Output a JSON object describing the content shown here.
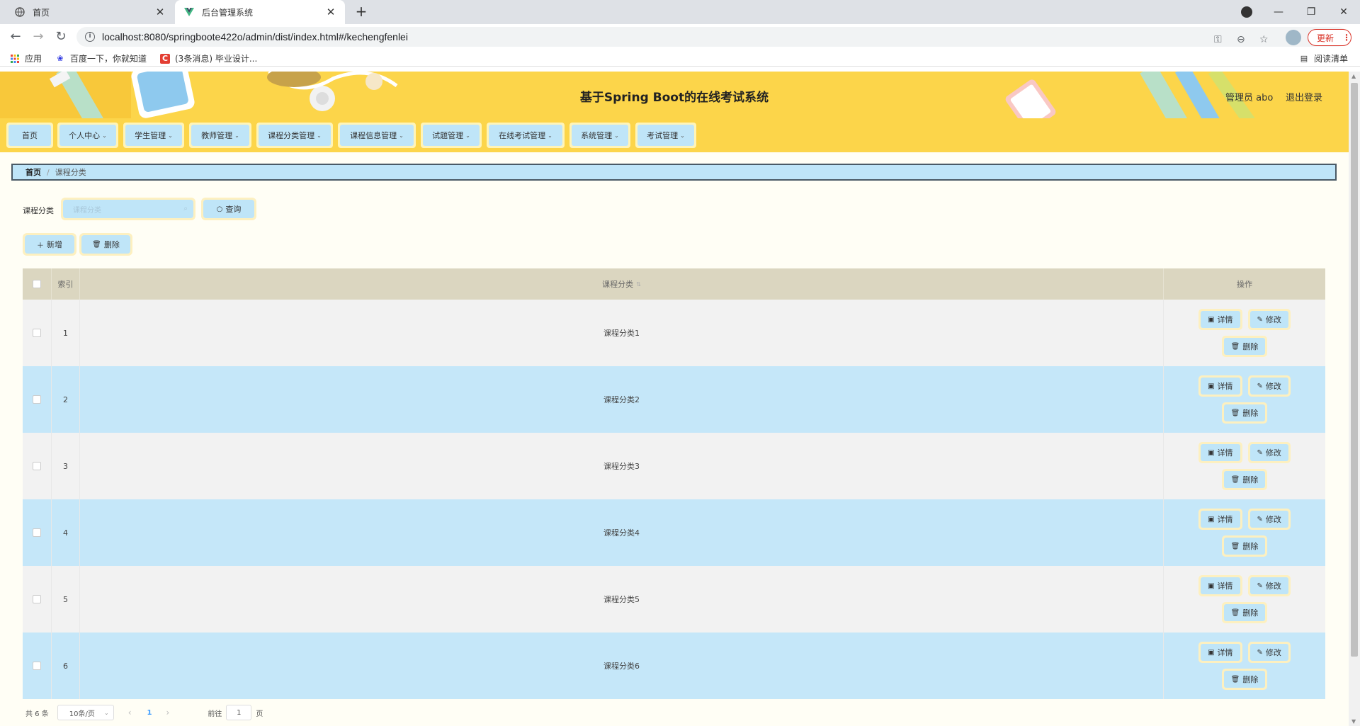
{
  "browser": {
    "tabs": [
      {
        "title": "首页",
        "icon": "globe-icon",
        "active": false
      },
      {
        "title": "后台管理系统",
        "icon": "vue-logo-icon",
        "active": true
      }
    ],
    "url": "localhost:8080/springboote422o/admin/dist/index.html#/kechengfenlei",
    "update_label": "更新",
    "bookmarks": [
      {
        "label": "应用",
        "icon": "apps-grid-icon"
      },
      {
        "label": "百度一下，你就知道",
        "icon": "baidu-paw-icon"
      },
      {
        "label": "(3条消息) 毕业设计...",
        "icon": "csdn-c-icon"
      }
    ],
    "reading_list": "阅读清单"
  },
  "header": {
    "title": "基于Spring Boot的在线考试系统",
    "user": "管理员 abo",
    "logout": "退出登录"
  },
  "menu": [
    {
      "label": "首页",
      "dropdown": false
    },
    {
      "label": "个人中心",
      "dropdown": true
    },
    {
      "label": "学生管理",
      "dropdown": true
    },
    {
      "label": "教师管理",
      "dropdown": true
    },
    {
      "label": "课程分类管理",
      "dropdown": true
    },
    {
      "label": "课程信息管理",
      "dropdown": true
    },
    {
      "label": "试题管理",
      "dropdown": true
    },
    {
      "label": "在线考试管理",
      "dropdown": true
    },
    {
      "label": "系统管理",
      "dropdown": true
    },
    {
      "label": "考试管理",
      "dropdown": true
    }
  ],
  "breadcrumb": {
    "home": "首页",
    "current": "课程分类"
  },
  "search": {
    "label": "课程分类",
    "placeholder": "课程分类",
    "button": "查询"
  },
  "actions": {
    "add": "新增",
    "delete": "删除"
  },
  "table": {
    "headers": {
      "index": "索引",
      "category": "课程分类",
      "operation": "操作"
    },
    "rows": [
      {
        "index": "1",
        "category": "课程分类1"
      },
      {
        "index": "2",
        "category": "课程分类2"
      },
      {
        "index": "3",
        "category": "课程分类3"
      },
      {
        "index": "4",
        "category": "课程分类4"
      },
      {
        "index": "5",
        "category": "课程分类5"
      },
      {
        "index": "6",
        "category": "课程分类6"
      }
    ],
    "row_actions": {
      "detail": "详情",
      "edit": "修改",
      "delete": "删除"
    }
  },
  "pagination": {
    "total": "共 6 条",
    "page_size": "10条/页",
    "current_page": "1",
    "goto_label": "前往",
    "goto_value": "1",
    "page_suffix": "页"
  },
  "colors": {
    "header_bg": "#fcd54a",
    "button_bg": "#bfe5f8",
    "button_border": "#fdf0c0",
    "row_alt": "#c5e7f9",
    "table_header": "#dbd6c0"
  }
}
